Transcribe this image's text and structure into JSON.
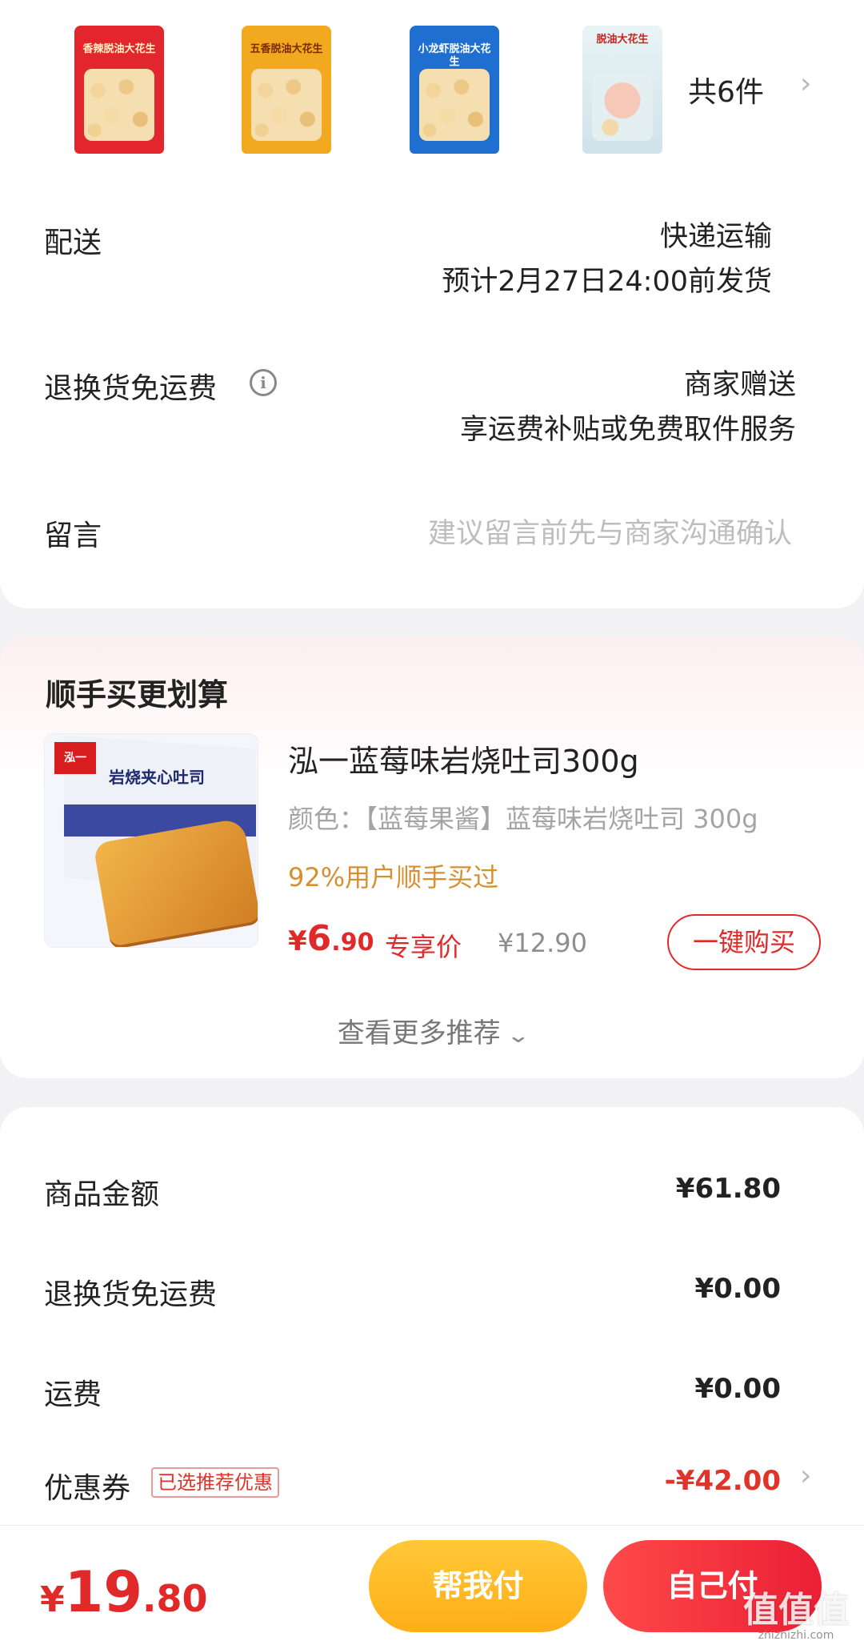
{
  "order": {
    "products": [
      {
        "name": "product-thumb-1",
        "color": "#e3262d",
        "label": "香辣脱油大花生"
      },
      {
        "name": "product-thumb-2",
        "color": "#f2a81f",
        "label": "五香脱油大花生"
      },
      {
        "name": "product-thumb-3",
        "color": "#1e6fd0",
        "label": "小龙虾脱油大花生"
      },
      {
        "name": "product-thumb-4",
        "color": "#d7e9ee",
        "label": "脱油大花生"
      }
    ],
    "count_label": "共6件",
    "delivery": {
      "label": "配送",
      "method": "快递运输",
      "eta": "预计2月27日24:00前发货"
    },
    "return_shipping": {
      "label": "退换货免运费",
      "provider": "商家赠送",
      "desc": "享运费补贴或免费取件服务"
    },
    "message": {
      "label": "留言",
      "placeholder": "建议留言前先与商家沟通确认"
    }
  },
  "recommend": {
    "title": "顺手买更划算",
    "product_name": "泓一蓝莓味岩烧吐司300g",
    "spec": "颜色：【蓝莓果酱】蓝莓味岩烧吐司 300g",
    "bought": "92%用户顺手买过",
    "price_currency": "¥",
    "price_int": "6",
    "price_dec": ".90",
    "price_tag": "专享价",
    "original_price": "¥12.90",
    "buy_label": "一键购买",
    "image_text": "岩烧夹心吐司",
    "image_logo": "泓一",
    "more_label": "查看更多推荐"
  },
  "amounts": {
    "goods_label": "商品金额",
    "goods_value": "¥61.80",
    "return_label": "退换货免运费",
    "return_value": "¥0.00",
    "shipping_label": "运费",
    "shipping_value": "¥0.00",
    "coupon_label": "优惠券",
    "coupon_badge": "已选推荐优惠",
    "coupon_value": "-¥42.00"
  },
  "bottom": {
    "total_currency": "¥",
    "total_int": "19",
    "total_dec": ".80",
    "pay_friend_label": "帮我付",
    "pay_self_label": "自己付",
    "watermark": "值值值",
    "watermark_sub": "zhizhizhi.com"
  },
  "colors": {
    "accent_red": "#e02a2a",
    "gold": "#ffb41f",
    "bought_orange": "#d68f32"
  }
}
